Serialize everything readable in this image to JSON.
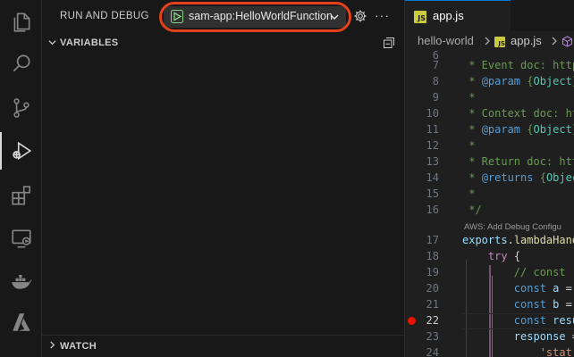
{
  "activity_bar": {
    "items": [
      {
        "icon": "explorer-icon"
      },
      {
        "icon": "search-icon"
      },
      {
        "icon": "source-control-icon"
      },
      {
        "icon": "run-and-debug-icon",
        "active": true
      },
      {
        "icon": "extensions-icon"
      },
      {
        "icon": "remote-explorer-icon"
      },
      {
        "icon": "docker-icon"
      },
      {
        "icon": "azure-icon"
      }
    ]
  },
  "debug": {
    "title": "RUN AND DEBUG",
    "configuration": "sam-app:HelloWorldFunction",
    "highlight_color": "#e2411b"
  },
  "sections": {
    "variables": "VARIABLES",
    "watch": "WATCH"
  },
  "editor": {
    "tab": {
      "badge": "JS",
      "name": "app.js"
    },
    "breadcrumb": {
      "folder": "hello-world",
      "file": "app.js"
    },
    "codelens": "AWS: Add Debug Configu",
    "lines": [
      {
        "n": "6",
        "text": ""
      },
      {
        "n": "7",
        "tokens": [
          [
            "c-comment",
            " * Event doc: "
          ],
          [
            "c-comment",
            "http"
          ]
        ]
      },
      {
        "n": "8",
        "tokens": [
          [
            "c-comment",
            " * "
          ],
          [
            "c-doc",
            "@param"
          ],
          [
            "c-comment",
            " {"
          ],
          [
            "c-type",
            "Object"
          ],
          [
            "c-comment",
            "}"
          ]
        ]
      },
      {
        "n": "9",
        "tokens": [
          [
            "c-comment",
            " *"
          ]
        ]
      },
      {
        "n": "10",
        "tokens": [
          [
            "c-comment",
            " * Context doc: "
          ],
          [
            "c-comment",
            "ht"
          ]
        ]
      },
      {
        "n": "11",
        "tokens": [
          [
            "c-comment",
            " * "
          ],
          [
            "c-doc",
            "@param"
          ],
          [
            "c-comment",
            " {"
          ],
          [
            "c-type",
            "Object"
          ],
          [
            "c-comment",
            "}"
          ]
        ]
      },
      {
        "n": "12",
        "tokens": [
          [
            "c-comment",
            " *"
          ]
        ]
      },
      {
        "n": "13",
        "tokens": [
          [
            "c-comment",
            " * Return doc: "
          ],
          [
            "c-comment",
            "htt"
          ]
        ]
      },
      {
        "n": "14",
        "tokens": [
          [
            "c-comment",
            " * "
          ],
          [
            "c-doc",
            "@returns"
          ],
          [
            "c-comment",
            " {"
          ],
          [
            "c-type",
            "Objec"
          ]
        ]
      },
      {
        "n": "15",
        "tokens": [
          [
            "c-comment",
            " *"
          ]
        ]
      },
      {
        "n": "16",
        "tokens": [
          [
            "c-comment",
            " */"
          ]
        ]
      },
      {
        "n": "17",
        "tokens": [
          [
            "c-var",
            "exports"
          ],
          [
            "c-plain",
            "."
          ],
          [
            "c-fn",
            "lambdaHand"
          ]
        ]
      },
      {
        "n": "18",
        "tokens": [
          [
            "c-plain",
            "    "
          ],
          [
            "c-keyword",
            "try"
          ],
          [
            "c-plain",
            " {"
          ]
        ]
      },
      {
        "n": "19",
        "tokens": [
          [
            "c-plain",
            "        "
          ],
          [
            "c-comment",
            "// const"
          ]
        ]
      },
      {
        "n": "20",
        "tokens": [
          [
            "c-plain",
            "        "
          ],
          [
            "c-storage",
            "const"
          ],
          [
            "c-plain",
            " "
          ],
          [
            "c-var",
            "a"
          ],
          [
            "c-plain",
            " ="
          ]
        ]
      },
      {
        "n": "21",
        "tokens": [
          [
            "c-plain",
            "        "
          ],
          [
            "c-storage",
            "const"
          ],
          [
            "c-plain",
            " "
          ],
          [
            "c-var",
            "b"
          ],
          [
            "c-plain",
            " ="
          ]
        ]
      },
      {
        "n": "22",
        "tokens": [
          [
            "c-plain",
            "        "
          ],
          [
            "c-storage",
            "const"
          ],
          [
            "c-plain",
            " "
          ],
          [
            "c-var",
            "resu"
          ]
        ],
        "current": true,
        "breakpoint": true
      },
      {
        "n": "23",
        "tokens": [
          [
            "c-plain",
            "        "
          ],
          [
            "c-var",
            "response"
          ],
          [
            "c-plain",
            " ="
          ]
        ]
      },
      {
        "n": "24",
        "tokens": [
          [
            "c-plain",
            "            "
          ],
          [
            "c-str",
            "'stat"
          ]
        ]
      }
    ]
  }
}
